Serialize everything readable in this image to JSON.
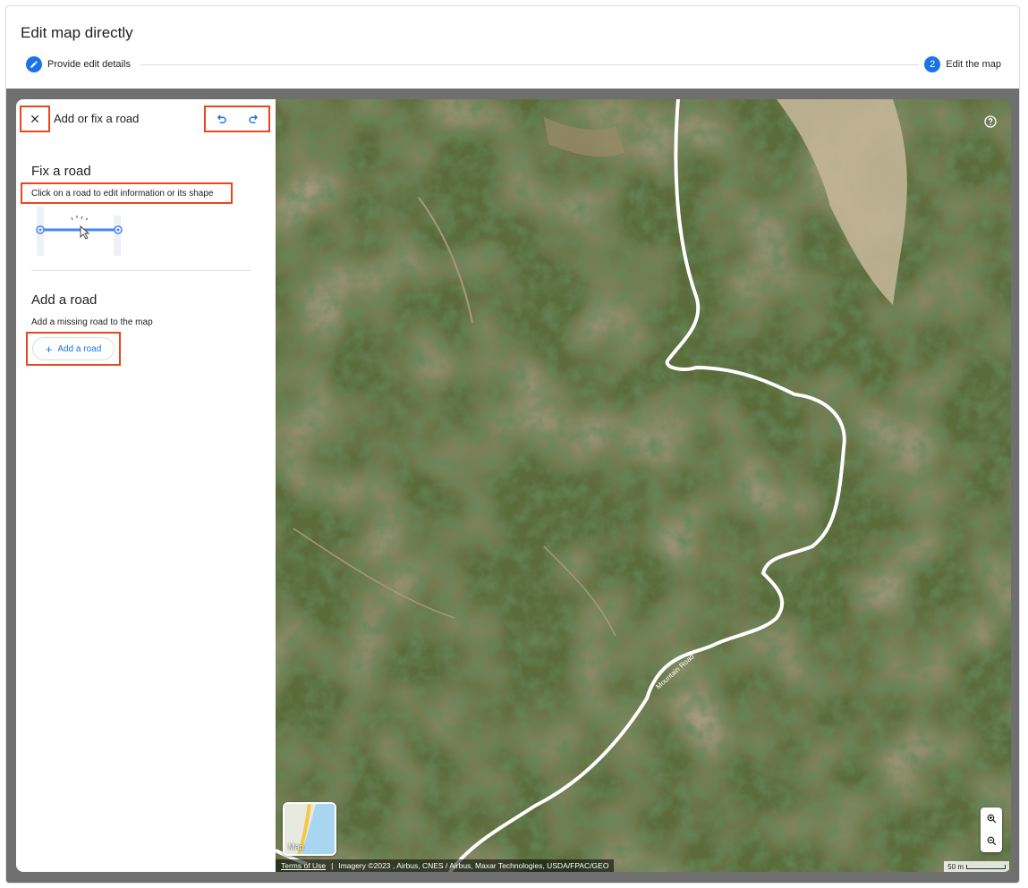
{
  "dialog": {
    "title": "Edit map directly"
  },
  "stepper": {
    "step1": {
      "label": "Provide edit details",
      "icon": "pencil-icon"
    },
    "step2": {
      "number": "2",
      "label": "Edit the map"
    }
  },
  "panel": {
    "header_title": "Add or fix a road",
    "fix": {
      "title": "Fix a road",
      "description": "Click on a road to edit information or its shape"
    },
    "add": {
      "title": "Add a road",
      "description": "Add a missing road to the map",
      "button_label": "Add a road",
      "button_icon": "+"
    }
  },
  "map": {
    "road_label": "Mountain Road",
    "thumbnail_label": "Map",
    "attribution": {
      "terms": "Terms of Use",
      "imagery": "Imagery ©2023 , Airbus, CNES / Airbus, Maxar Technologies, USDA/FPAC/GEO"
    },
    "scale_label": "50 m"
  },
  "colors": {
    "accent": "#1a73e8",
    "highlight": "#e8471c",
    "frame": "#6f6f6f"
  }
}
